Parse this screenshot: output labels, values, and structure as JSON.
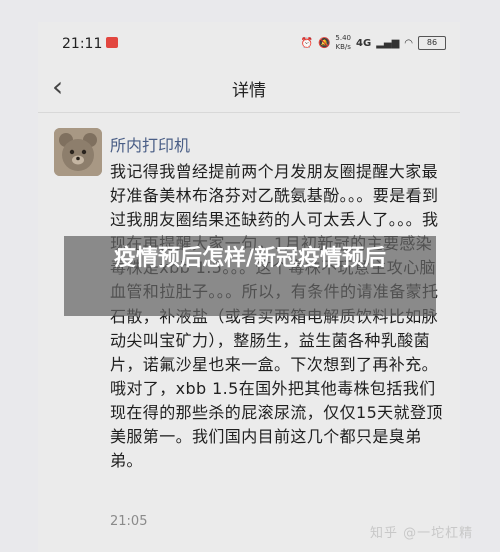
{
  "status_bar": {
    "time": "21:11",
    "speed_value": "5.40",
    "speed_unit": "KB/s",
    "network": "4G",
    "battery": "86"
  },
  "nav": {
    "back_icon": "chevron-left-icon",
    "title": "详情"
  },
  "message": {
    "sender": "所内打印机",
    "text": "我记得我曾经提前两个月发朋友圈提醒大家最好准备美林布洛芬对乙酰氨基酚。。。要是看到过我朋友圈结果还缺药的人可太丢人了。。。我现在再提醒大家一句，1月初新冠的主要感染毒株是xbb 1.5。。。这个毒株不玩意主攻心脑血管和拉肚子。。。所以，有条件的请准备蒙托石散，补液盐（或者买两箱电解质饮料比如脉动尖叫宝矿力），整肠生，益生菌各种乳酸菌片，诺氟沙星也来一盒。下次想到了再补充。哦对了，xbb 1.5在国外把其他毒株包括我们现在得的那些杀的屁滚尿流，仅仅15天就登顶美服第一。我们国内目前这几个都只是臭弟弟。",
    "time": "21:05"
  },
  "overlay": {
    "title": "疫情预后怎样/新冠疫情预后"
  },
  "watermark": "知乎 @一坨杠精",
  "colors": {
    "sender_name": "#4a5e86",
    "overlay_bg": "rgba(100,100,100,0.72)",
    "status_badge": "#e2463f"
  }
}
